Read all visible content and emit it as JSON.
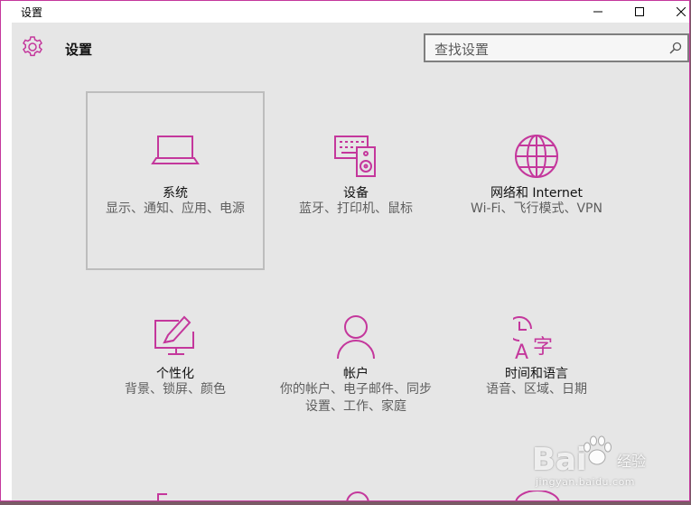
{
  "window": {
    "title": "设置",
    "accent_color": "#c4379c"
  },
  "header": {
    "title": "设置",
    "icon": "gear-icon"
  },
  "search": {
    "placeholder": "查找设置",
    "icon": "search-icon"
  },
  "tiles": [
    {
      "label": "系统",
      "desc": "显示、通知、应用、电源",
      "icon": "laptop-icon",
      "selected": true
    },
    {
      "label": "设备",
      "desc": "蓝牙、打印机、鼠标",
      "icon": "devices-icon",
      "selected": false
    },
    {
      "label": "网络和 Internet",
      "desc": "Wi-Fi、飞行模式、VPN",
      "icon": "globe-icon",
      "selected": false
    },
    {
      "label": "个性化",
      "desc": "背景、锁屏、颜色",
      "icon": "personalization-icon",
      "selected": false
    },
    {
      "label": "帐户",
      "desc": "你的帐户、电子邮件、同步设置、工作、家庭",
      "icon": "person-icon",
      "selected": false
    },
    {
      "label": "时间和语言",
      "desc": "语音、区域、日期",
      "icon": "time-language-icon",
      "selected": false
    }
  ],
  "watermark": {
    "logo": "Bai",
    "cn": "经验",
    "sub": "jingyan.baidu.com"
  }
}
